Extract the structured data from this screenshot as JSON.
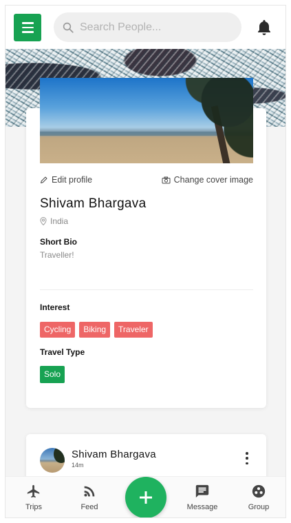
{
  "search": {
    "placeholder": "Search People..."
  },
  "profile": {
    "edit_label": "Edit profile",
    "change_cover_label": "Change cover image",
    "name": "Shivam Bhargava",
    "location": "India",
    "bio_title": "Short Bio",
    "bio": "Traveller!",
    "interest_title": "Interest",
    "interests": [
      "Cycling",
      "Biking",
      "Traveler"
    ],
    "travel_type_title": "Travel Type",
    "travel_type": "Solo"
  },
  "post": {
    "author": "Shivam Bhargava",
    "time": "14m"
  },
  "nav": {
    "trips": "Trips",
    "feed": "Feed",
    "message": "Message",
    "group": "Group"
  },
  "colors": {
    "accent_green": "#17a252",
    "chip_red": "#ee6666"
  },
  "icons": [
    "menu-icon",
    "search-icon",
    "bell-icon",
    "pencil-icon",
    "camera-icon",
    "location-pin-icon",
    "more-vert-icon",
    "airplane-icon",
    "rss-feed-icon",
    "plus-icon",
    "message-icon",
    "group-icon"
  ]
}
